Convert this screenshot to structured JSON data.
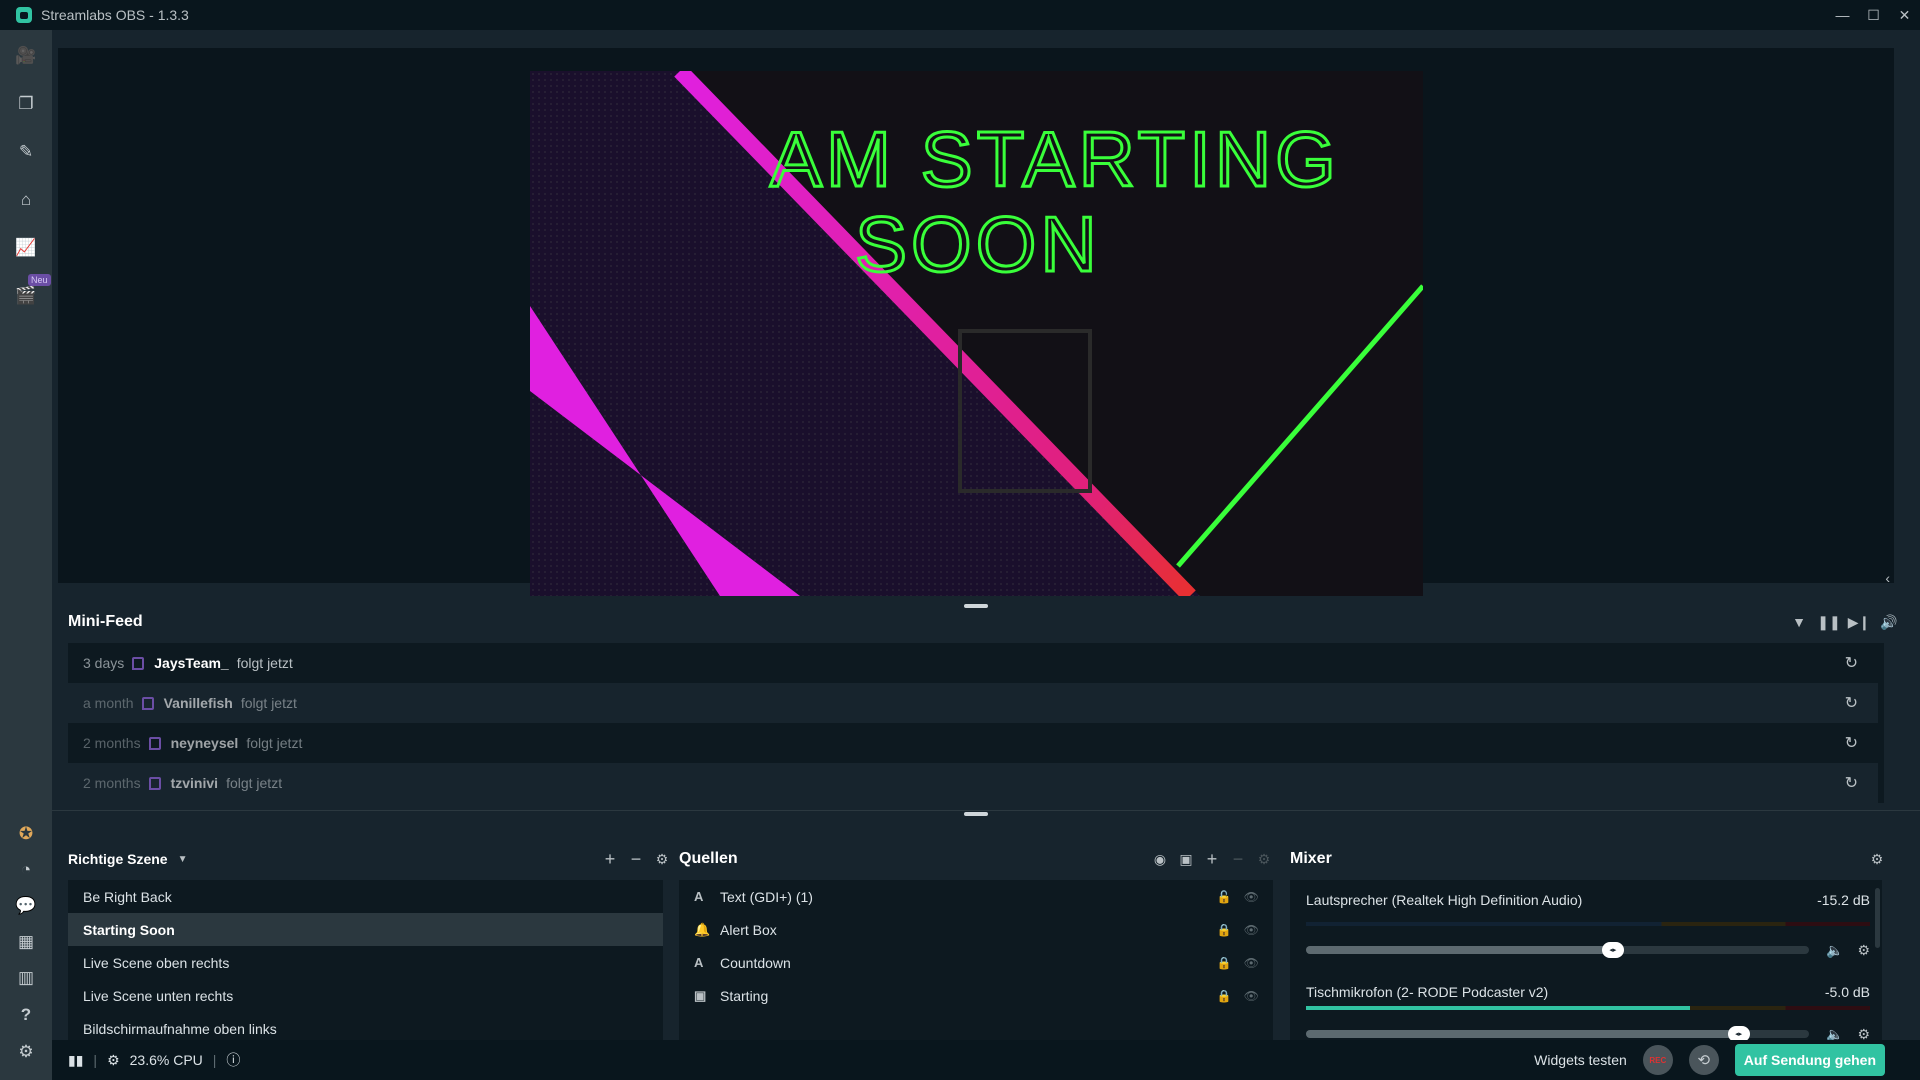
{
  "window": {
    "title": "Streamlabs OBS - 1.3.3",
    "controls": {
      "minimize": "—",
      "maximize": "☐",
      "close": "✕"
    }
  },
  "sidebar": {
    "top_items": [
      {
        "name": "editor",
        "icon": "video-camera-icon",
        "glyph": "🎥",
        "active": true
      },
      {
        "name": "layout",
        "icon": "layers-icon",
        "glyph": "❐"
      },
      {
        "name": "themes",
        "icon": "themes-icon",
        "glyph": "✎"
      },
      {
        "name": "store",
        "icon": "store-icon",
        "glyph": "⌂"
      },
      {
        "name": "dashboard",
        "icon": "chart-icon",
        "glyph": "📈"
      },
      {
        "name": "studio-mode",
        "icon": "clapper-icon",
        "glyph": "🎬",
        "badge": "Neu"
      }
    ],
    "bottom_items": [
      {
        "name": "prime",
        "icon": "prime-star-icon",
        "glyph": "✪"
      },
      {
        "name": "dashboard-link",
        "icon": "gauge-icon",
        "glyph": "◔"
      },
      {
        "name": "chat",
        "icon": "chat-icon",
        "glyph": "💬"
      },
      {
        "name": "apps",
        "icon": "grid-icon",
        "glyph": "▦"
      },
      {
        "name": "layout-editor",
        "icon": "columns-icon",
        "glyph": "▥"
      },
      {
        "name": "help",
        "icon": "help-icon",
        "glyph": "?"
      },
      {
        "name": "settings",
        "icon": "gear-icon",
        "glyph": "⚙"
      }
    ]
  },
  "preview": {
    "overlay_text_line1": "AM STARTING",
    "overlay_text_line2": "SOON",
    "accent_pink": "#e020e0",
    "accent_green": "#39ff3a"
  },
  "minifeed": {
    "title": "Mini-Feed",
    "controls": [
      "filter-icon",
      "pause-icon",
      "skip-icon",
      "volume-icon"
    ],
    "items": [
      {
        "time": "3 days",
        "user": "JaysTeam_",
        "action": "folgt jetzt"
      },
      {
        "time": "a month",
        "user": "Vanillefish",
        "action": "folgt jetzt"
      },
      {
        "time": "2 months",
        "user": "neyneysel",
        "action": "folgt jetzt"
      },
      {
        "time": "2 months",
        "user": "tzvinivi",
        "action": "folgt jetzt"
      }
    ]
  },
  "scenes": {
    "title": "Richtige Szene",
    "items": [
      {
        "label": "Be Right Back"
      },
      {
        "label": "Starting Soon",
        "selected": true
      },
      {
        "label": "Live Scene oben rechts"
      },
      {
        "label": "Live Scene unten rechts"
      },
      {
        "label": "Bildschirmaufnahme oben links"
      }
    ]
  },
  "sources": {
    "title": "Quellen",
    "items": [
      {
        "type": "A",
        "type_icon": "text-icon",
        "label": "Text (GDI+) (1)",
        "locked": false
      },
      {
        "type": "🔔",
        "type_icon": "bell-icon",
        "label": "Alert Box",
        "locked": true
      },
      {
        "type": "A",
        "type_icon": "text-icon",
        "label": "Countdown",
        "locked": true
      },
      {
        "type": "▣",
        "type_icon": "image-icon",
        "label": "Starting",
        "locked": true
      }
    ]
  },
  "mixer": {
    "title": "Mixer",
    "items": [
      {
        "name": "Lautsprecher (Realtek High Definition Audio)",
        "db": "-15.2 dB",
        "volume": 0.61,
        "level": 0.0
      },
      {
        "name": "Tischmikrofon (2- RODE Podcaster v2)",
        "db": "-5.0 dB",
        "volume": 0.86,
        "level": 0.68
      }
    ]
  },
  "footer": {
    "cpu": "23.6% CPU",
    "widgets_test": "Widgets testen",
    "rec_label": "REC",
    "go_live": "Auf Sendung gehen",
    "accent": "#31c3a2"
  }
}
